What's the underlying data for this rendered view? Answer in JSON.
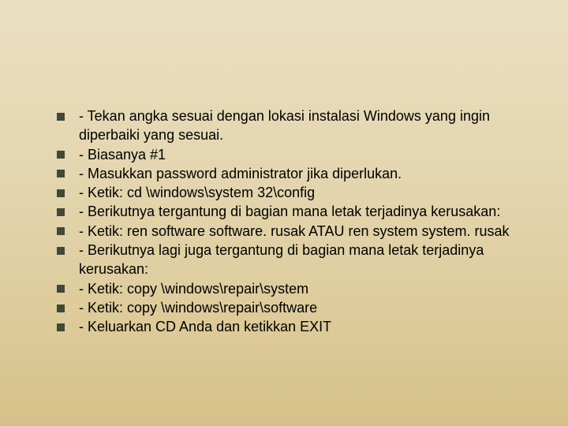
{
  "items": [
    "- Tekan angka sesuai dengan lokasi instalasi Windows yang ingin diperbaiki yang sesuai.",
    "- Biasanya #1",
    "- Masukkan password administrator jika diperlukan.",
    "- Ketik: cd \\windows\\system 32\\config",
    "- Berikutnya tergantung di bagian mana letak terjadinya kerusakan:",
    "- Ketik: ren software software. rusak ATAU ren system system. rusak",
    "- Berikutnya lagi juga tergantung di bagian mana letak terjadinya kerusakan:",
    "- Ketik: copy \\windows\\repair\\system",
    "- Ketik: copy \\windows\\repair\\software",
    "- Keluarkan CD Anda dan ketikkan EXIT"
  ]
}
